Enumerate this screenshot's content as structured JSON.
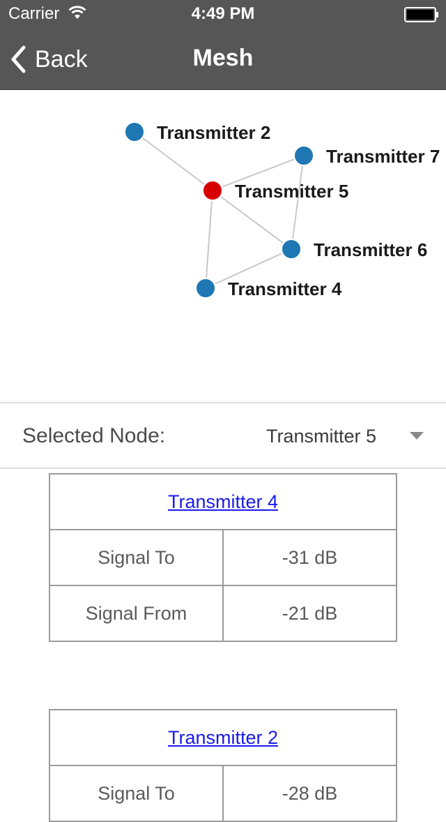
{
  "status_bar": {
    "carrier": "Carrier",
    "time": "4:49 PM"
  },
  "nav": {
    "back_label": "Back",
    "title": "Mesh"
  },
  "graph": {
    "nodes": [
      {
        "id": "t2",
        "label": "Transmitter 2",
        "color": "#1f77b4"
      },
      {
        "id": "t7",
        "label": "Transmitter 7",
        "color": "#1f77b4"
      },
      {
        "id": "t5",
        "label": "Transmitter 5",
        "color": "#d60000"
      },
      {
        "id": "t6",
        "label": "Transmitter 6",
        "color": "#1f77b4"
      },
      {
        "id": "t4",
        "label": "Transmitter 4",
        "color": "#1f77b4"
      }
    ],
    "links": [
      [
        "t2",
        "t5"
      ],
      [
        "t5",
        "t7"
      ],
      [
        "t7",
        "t6"
      ],
      [
        "t5",
        "t6"
      ],
      [
        "t5",
        "t4"
      ],
      [
        "t6",
        "t4"
      ]
    ],
    "link_color": "#c8c8c8"
  },
  "selector": {
    "label": "Selected Node:",
    "value": "Transmitter 5"
  },
  "tables": [
    {
      "title": "Transmitter 4",
      "rows": [
        {
          "label": "Signal To",
          "value": "-31 dB"
        },
        {
          "label": "Signal From",
          "value": "-21 dB"
        }
      ]
    },
    {
      "title": "Transmitter 2",
      "rows": [
        {
          "label": "Signal To",
          "value": "-28 dB"
        }
      ]
    }
  ]
}
